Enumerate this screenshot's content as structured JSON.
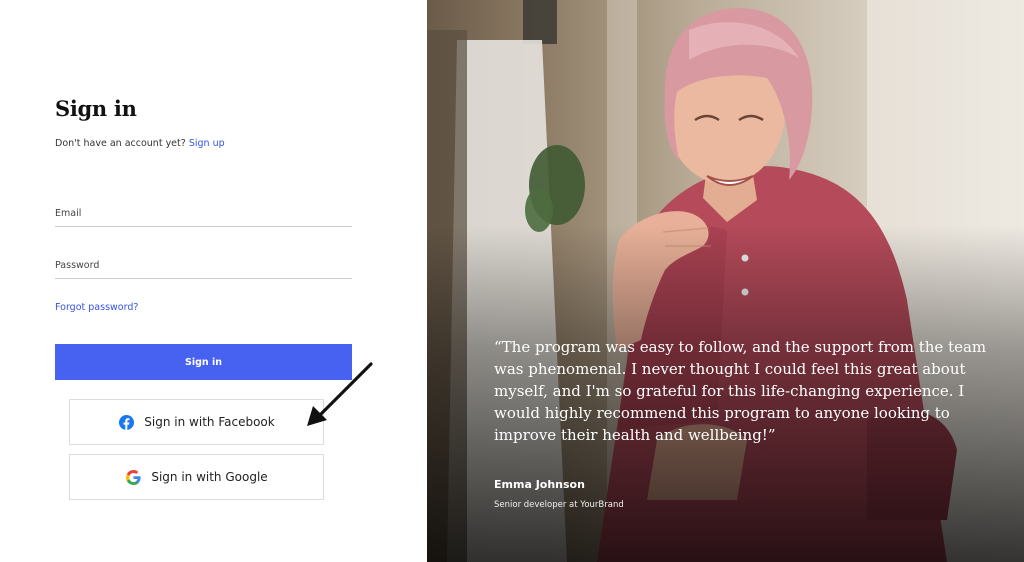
{
  "signin": {
    "title": "Sign in",
    "no_account_text": "Don't have an account yet?",
    "signup_link": "Sign up",
    "email_placeholder": "Email",
    "password_placeholder": "Password",
    "forgot_password": "Forgot password?",
    "submit_label": "Sign in",
    "facebook_label": "Sign in with Facebook",
    "google_label": "Sign in with Google"
  },
  "testimonial": {
    "quote": "“The program was easy to follow, and the support from the team was phenomenal. I never thought I could feel this great about myself, and I'm so grateful for this life-changing experience. I would highly recommend this program to anyone looking to improve their health and wellbeing!”",
    "author_name": "Emma Johnson",
    "author_role": "Senior developer at YourBrand"
  },
  "icons": {
    "facebook": "facebook-icon",
    "google": "google-icon",
    "arrow": "annotation-arrow"
  },
  "colors": {
    "primary": "#4761f1",
    "link": "#3553e6",
    "facebook": "#1877f2",
    "google": "#ea4335"
  }
}
